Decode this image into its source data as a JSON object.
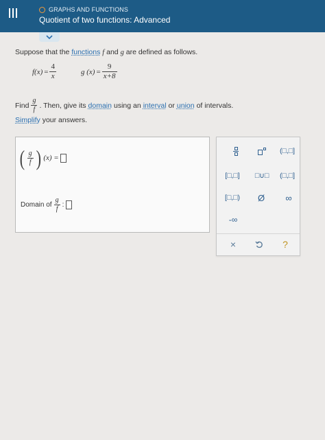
{
  "header": {
    "module": "GRAPHS AND FUNCTIONS",
    "topic": "Quotient of two functions: Advanced"
  },
  "problem": {
    "intro_before": "Suppose that the ",
    "intro_link": "functions",
    "intro_f": "f",
    "intro_and": "and",
    "intro_g": "g",
    "intro_after": "are defined as follows.",
    "f_lhs": "f(x)",
    "f_num": "4",
    "f_den": "x",
    "g_lhs": "g (x)",
    "g_num": "9",
    "g_den": "x+8",
    "equals": "=",
    "find_label": "Find",
    "find_num": "g",
    "find_den": "f",
    "then_text": ". Then, give its",
    "domain_link": "domain",
    "using_text": "using an",
    "interval_link": "interval",
    "or_text": "or",
    "union_link": "union",
    "of_intervals": "of intervals.",
    "simplify_link": "Simplify",
    "your_answers": "your answers."
  },
  "answer": {
    "quot_num": "g",
    "quot_den": "f",
    "x_part": "(x) =",
    "domain_label": "Domain of",
    "domain_num": "g",
    "domain_den": "f",
    "colon": ":"
  },
  "keypad": {
    "interval_open_closed": "(□,□]",
    "interval_closed_closed": "[□,□]",
    "union": "□∪□",
    "interval_closed_open": "[□,□)",
    "interval_open_closed_2": "(□,□]",
    "empty_set": "Ø",
    "infinity": "∞",
    "neg_infinity": "-∞",
    "clear": "×",
    "help": "?"
  }
}
